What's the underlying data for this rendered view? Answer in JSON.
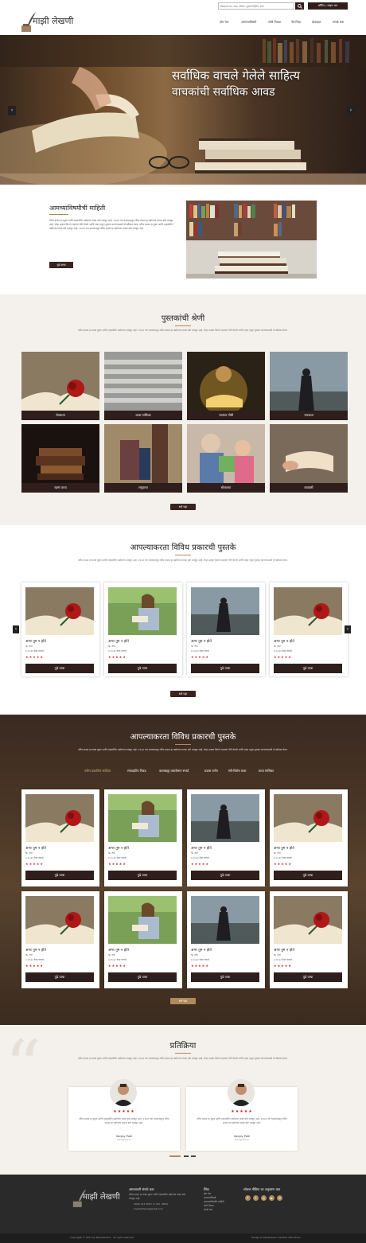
{
  "header": {
    "search_placeholder": "लेखकाचे नाव, कथा, कविता, पुस्तक लिहिणे, कथा",
    "login_label": "लॉगिन / साइन अप",
    "logo_text": "माझी लेखणी",
    "nav": [
      "होम पेज",
      "आमच्याविषयी",
      "श्रेणी निवडा",
      "नेवे लिहा",
      "प्रोफाइल",
      "संपर्क करा"
    ]
  },
  "hero": {
    "line1": "सर्वाधिक वाचले गेलेले साहित्य",
    "line2": "वाचकांची सर्वाधिक आवड"
  },
  "about": {
    "title": "आमच्याविषयीची माहिती",
    "body": "लॉरेम इप्सम हा मुद्रण आणि टाइपसेटिंग उद्योगाचा फक्त डमी मजकूर आहे. 1500 च्या दशकापासून लॉरेम इप्सम हा उद्योगाचा मानक डमी मजकूर आहे, जेव्हा अज्ञात प्रिंटरने टाइपचा गॅली घेतली आणि टाइप नमुना पुस्तक बनवण्यासाठी तो स्क्रॅम्बल केला. लॉरेम इप्सम हा मुद्रण आणि टाइपसेटिंग उद्योगाचा फक्त डमी मजकूर आहे. 1500 च्या दशकापासून लॉरेम इप्सम हा उद्योगाचा मानक डमी मजकूर आहे.",
    "button": "पुढे वाचा"
  },
  "categories": {
    "title": "पुस्तकांची श्रेणी",
    "desc": "लॉरेम इप्सम हा फक्त मुद्रण आणि टाइपसेटिंग उद्योगाचा मजकूर आहे. 1500 च्या दशकापासून लॉरेम इप्सम हा उद्योगाचा मानक डमी मजकूर आहे, जेव्हा अज्ञात प्रिंटरने टाइपचा गॅली घेतली आणि टाइप नमुना पुस्तक बनवण्यासाठी तो स्क्रॅम्बल केला.",
    "items": [
      "प्रेमकथा",
      "कथा मालिका",
      "भटकंत गोष्टी",
      "भयकथा",
      "रहस्य कथा",
      "लघुकथा",
      "बोधकथा",
      "कादंबरी"
    ],
    "button": "सर्व पहा"
  },
  "books1": {
    "title": "आपल्याकरता विविध प्रकारची  पुस्तके",
    "desc": "लॉरेम इप्सम हा फक्त मुद्रण आणि टाइपसेटिंग उद्योगाचा मजकूर आहे. 1500 च्या दशकापासून लॉरेम इप्सम हा उद्योगाचा मानक डमी मजकूर आहे, जेव्हा अज्ञात प्रिंटरने टाइपचा गॅली घेतली आणि टाइप नमुना पुस्तक बनवण्यासाठी तो स्क्रॅम्बल केला.",
    "book_title": "अगर तुम न होते",
    "book_author": "ऋ. तपा",
    "book_views": "४,२३,४२ वेळा वाचले",
    "stars": "★★★★★",
    "button": "पुढे वाचा",
    "more": "सर्व पहा"
  },
  "books2": {
    "title": "आपल्याकरता विविध प्रकारची  पुस्तके",
    "desc": "लॉरेम इप्सम हा फक्त मुद्रण आणि टाइपसेटिंग उद्योगाचा मजकूर आहे. 1500 च्या दशकापासून लॉरेम इप्सम हा उद्योगाचा मानक डमी मजकूर आहे, जेव्हा अज्ञात प्रिंटरने टाइपचा गॅली घेतली आणि टाइप नमुना पुस्तक बनवण्यासाठी तो स्क्रॅम्बल केला.",
    "tabs": [
      "नवीन प्रकाशित साहित्य",
      "संपादकीय निवड",
      "कालबाह्य करावेसान स्पर्धा",
      "प्रवास वर्णन",
      "स्त्री-विशेष कथा",
      "कथा मालिका"
    ],
    "more": "सर्व पहा"
  },
  "feedback": {
    "title": "प्रतिक्रिया",
    "desc": "लॉरेम इप्सम हा फक्त मुद्रण आणि टाइपसेटिंग उद्योगाचा मजकूर आहे. 1500 च्या दशकापासून लॉरेम इप्सम हा उद्योगाचा मानक डमी मजकूर आहे, जेव्हा अज्ञात प्रिंटरने टाइपचा गॅली घेतली आणि टाइप नमुना पुस्तक बनवण्यासाठी तो स्क्रॅम्बल केला.",
    "items": [
      {
        "stars": "★★★★★",
        "text": "लॉरेम इप्सम हा मुद्रण आणि टाइपसेटिंग उद्योगाचा फक्त डमी मजकूर आहे. 1500 च्या दशकापासून लॉरेम इप्सम हा उद्योगाचा मानक डमी मजकूर आहे.",
        "name": "Sanjay Patil",
        "role": "Designation"
      },
      {
        "stars": "★★★★★",
        "text": "लॉरेम इप्सम हा मुद्रण आणि टाइपसेटिंग उद्योगाचा फक्त डमी मजकूर आहे. 1500 च्या दशकापासून लॉरेम इप्सम हा उद्योगाचा मानक डमी मजकूर आहे.",
        "name": "Sanjay Patil",
        "role": "Designation"
      }
    ]
  },
  "footer": {
    "logo_text": "माझी लेखणी",
    "contact_title": "आमच्याशी संपर्क करा",
    "contact_text": "लॉरेम इप्सम हा फक्त मुद्रण आणि टाइपसेटिंग उद्योगाचा फक्त डमी मजकूर आहे.",
    "phone": "1800 123 4567 (7 AM - 8PM)",
    "email": "mazilekhani@gmail.com",
    "links_title": "लिंक",
    "links": [
      "होम पेज",
      "आमच्याविषयी",
      "आमच्याविषयीचे माहिती",
      "श्रेणी निवडा",
      "संपर्क करा"
    ],
    "social_title": "सोशल मीडिया वर अनुसरण करा",
    "copyright": "Copyright © 2021 by MaziLekhani . All right reserved",
    "credit": "Design & Developed: Creative web Techs"
  }
}
